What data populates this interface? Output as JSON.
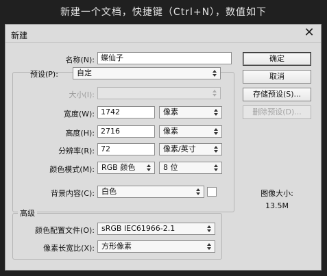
{
  "caption": "新建一个文档，快捷键（Ctrl+N），数值如下",
  "dialog": {
    "title": "新建",
    "close_glyph": "✕",
    "name": {
      "label": "名称(N):",
      "value": "蝶仙子"
    },
    "preset": {
      "label": "预设(P):",
      "value": "自定"
    },
    "size": {
      "label": "大小(I):",
      "value": ""
    },
    "width": {
      "label": "宽度(W):",
      "value": "1742",
      "unit": "像素"
    },
    "height": {
      "label": "高度(H):",
      "value": "2716",
      "unit": "像素"
    },
    "resolution": {
      "label": "分辨率(R):",
      "value": "72",
      "unit": "像素/英寸"
    },
    "color_mode": {
      "label": "颜色模式(M):",
      "value": "RGB 颜色",
      "depth": "8 位"
    },
    "background": {
      "label": "背景内容(C):",
      "value": "白色"
    },
    "advanced": {
      "legend": "高级",
      "color_profile": {
        "label": "颜色配置文件(O):",
        "value": "sRGB IEC61966-2.1"
      },
      "pixel_aspect": {
        "label": "像素长宽比(X):",
        "value": "方形像素"
      }
    },
    "buttons": {
      "ok": "确定",
      "cancel": "取消",
      "save_preset": "存储预设(S)...",
      "delete_preset": "删除预设(D)..."
    },
    "image_size": {
      "label": "图像大小:",
      "value": "13.5M"
    }
  }
}
